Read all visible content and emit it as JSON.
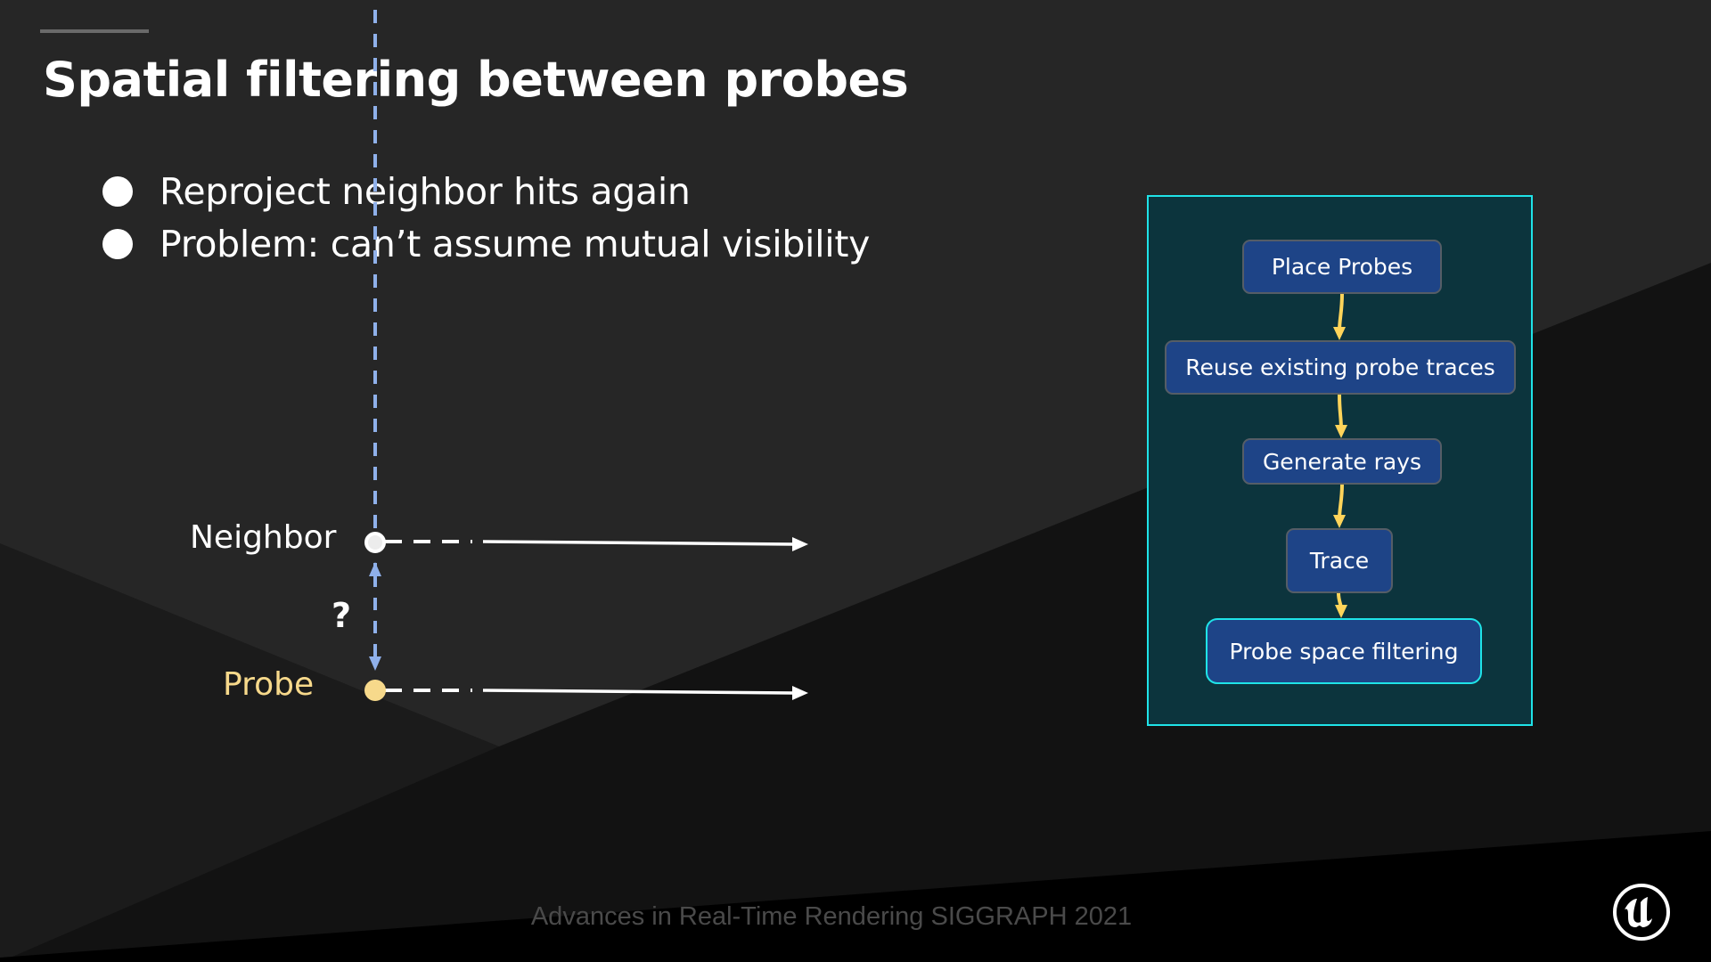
{
  "slide": {
    "title": "Spatial filtering between probes",
    "bullets": [
      "Reproject neighbor hits again",
      "Problem: can’t assume mutual visibility"
    ],
    "footer": "Advances in Real-Time Rendering SIGGRAPH 2021",
    "logo": "unreal-engine-logo-icon"
  },
  "diagram": {
    "neighbor_label": "Neighbor",
    "probe_label": "Probe",
    "question_mark": "?",
    "colors": {
      "neighbor": "#ffffff",
      "probe": "#f7d98b",
      "visibility_arrow": "#8fb0ea",
      "ray": "#ffffff"
    }
  },
  "pipeline": {
    "nodes": [
      {
        "label": "Place Probes",
        "active": false
      },
      {
        "label": "Reuse existing probe traces",
        "active": false
      },
      {
        "label": "Generate rays",
        "active": false
      },
      {
        "label": "Trace",
        "active": false
      },
      {
        "label": "Probe space filtering",
        "active": true
      }
    ],
    "colors": {
      "panel_bg": "#0c343d",
      "panel_border": "#1fe3e8",
      "node_bg": "#1e4487",
      "node_border": "#555d66",
      "active_border": "#1fe3e8",
      "edge": "#ffd45a"
    }
  }
}
